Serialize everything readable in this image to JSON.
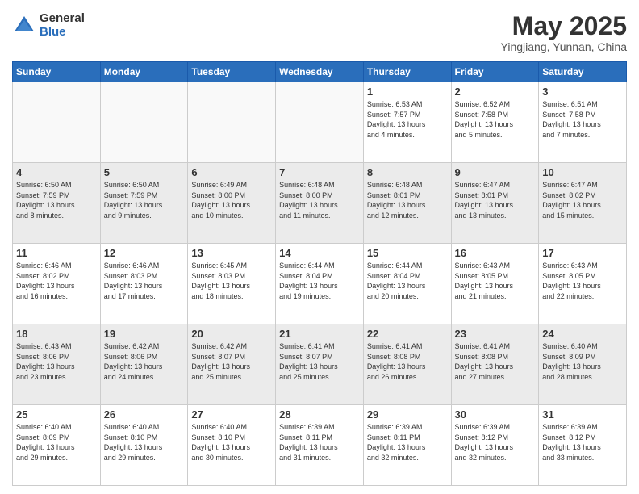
{
  "logo": {
    "general": "General",
    "blue": "Blue"
  },
  "header": {
    "month": "May 2025",
    "location": "Yingjiang, Yunnan, China"
  },
  "weekdays": [
    "Sunday",
    "Monday",
    "Tuesday",
    "Wednesday",
    "Thursday",
    "Friday",
    "Saturday"
  ],
  "weeks": [
    [
      {
        "day": "",
        "info": ""
      },
      {
        "day": "",
        "info": ""
      },
      {
        "day": "",
        "info": ""
      },
      {
        "day": "",
        "info": ""
      },
      {
        "day": "1",
        "info": "Sunrise: 6:53 AM\nSunset: 7:57 PM\nDaylight: 13 hours\nand 4 minutes."
      },
      {
        "day": "2",
        "info": "Sunrise: 6:52 AM\nSunset: 7:58 PM\nDaylight: 13 hours\nand 5 minutes."
      },
      {
        "day": "3",
        "info": "Sunrise: 6:51 AM\nSunset: 7:58 PM\nDaylight: 13 hours\nand 7 minutes."
      }
    ],
    [
      {
        "day": "4",
        "info": "Sunrise: 6:50 AM\nSunset: 7:59 PM\nDaylight: 13 hours\nand 8 minutes."
      },
      {
        "day": "5",
        "info": "Sunrise: 6:50 AM\nSunset: 7:59 PM\nDaylight: 13 hours\nand 9 minutes."
      },
      {
        "day": "6",
        "info": "Sunrise: 6:49 AM\nSunset: 8:00 PM\nDaylight: 13 hours\nand 10 minutes."
      },
      {
        "day": "7",
        "info": "Sunrise: 6:48 AM\nSunset: 8:00 PM\nDaylight: 13 hours\nand 11 minutes."
      },
      {
        "day": "8",
        "info": "Sunrise: 6:48 AM\nSunset: 8:01 PM\nDaylight: 13 hours\nand 12 minutes."
      },
      {
        "day": "9",
        "info": "Sunrise: 6:47 AM\nSunset: 8:01 PM\nDaylight: 13 hours\nand 13 minutes."
      },
      {
        "day": "10",
        "info": "Sunrise: 6:47 AM\nSunset: 8:02 PM\nDaylight: 13 hours\nand 15 minutes."
      }
    ],
    [
      {
        "day": "11",
        "info": "Sunrise: 6:46 AM\nSunset: 8:02 PM\nDaylight: 13 hours\nand 16 minutes."
      },
      {
        "day": "12",
        "info": "Sunrise: 6:46 AM\nSunset: 8:03 PM\nDaylight: 13 hours\nand 17 minutes."
      },
      {
        "day": "13",
        "info": "Sunrise: 6:45 AM\nSunset: 8:03 PM\nDaylight: 13 hours\nand 18 minutes."
      },
      {
        "day": "14",
        "info": "Sunrise: 6:44 AM\nSunset: 8:04 PM\nDaylight: 13 hours\nand 19 minutes."
      },
      {
        "day": "15",
        "info": "Sunrise: 6:44 AM\nSunset: 8:04 PM\nDaylight: 13 hours\nand 20 minutes."
      },
      {
        "day": "16",
        "info": "Sunrise: 6:43 AM\nSunset: 8:05 PM\nDaylight: 13 hours\nand 21 minutes."
      },
      {
        "day": "17",
        "info": "Sunrise: 6:43 AM\nSunset: 8:05 PM\nDaylight: 13 hours\nand 22 minutes."
      }
    ],
    [
      {
        "day": "18",
        "info": "Sunrise: 6:43 AM\nSunset: 8:06 PM\nDaylight: 13 hours\nand 23 minutes."
      },
      {
        "day": "19",
        "info": "Sunrise: 6:42 AM\nSunset: 8:06 PM\nDaylight: 13 hours\nand 24 minutes."
      },
      {
        "day": "20",
        "info": "Sunrise: 6:42 AM\nSunset: 8:07 PM\nDaylight: 13 hours\nand 25 minutes."
      },
      {
        "day": "21",
        "info": "Sunrise: 6:41 AM\nSunset: 8:07 PM\nDaylight: 13 hours\nand 25 minutes."
      },
      {
        "day": "22",
        "info": "Sunrise: 6:41 AM\nSunset: 8:08 PM\nDaylight: 13 hours\nand 26 minutes."
      },
      {
        "day": "23",
        "info": "Sunrise: 6:41 AM\nSunset: 8:08 PM\nDaylight: 13 hours\nand 27 minutes."
      },
      {
        "day": "24",
        "info": "Sunrise: 6:40 AM\nSunset: 8:09 PM\nDaylight: 13 hours\nand 28 minutes."
      }
    ],
    [
      {
        "day": "25",
        "info": "Sunrise: 6:40 AM\nSunset: 8:09 PM\nDaylight: 13 hours\nand 29 minutes."
      },
      {
        "day": "26",
        "info": "Sunrise: 6:40 AM\nSunset: 8:10 PM\nDaylight: 13 hours\nand 29 minutes."
      },
      {
        "day": "27",
        "info": "Sunrise: 6:40 AM\nSunset: 8:10 PM\nDaylight: 13 hours\nand 30 minutes."
      },
      {
        "day": "28",
        "info": "Sunrise: 6:39 AM\nSunset: 8:11 PM\nDaylight: 13 hours\nand 31 minutes."
      },
      {
        "day": "29",
        "info": "Sunrise: 6:39 AM\nSunset: 8:11 PM\nDaylight: 13 hours\nand 32 minutes."
      },
      {
        "day": "30",
        "info": "Sunrise: 6:39 AM\nSunset: 8:12 PM\nDaylight: 13 hours\nand 32 minutes."
      },
      {
        "day": "31",
        "info": "Sunrise: 6:39 AM\nSunset: 8:12 PM\nDaylight: 13 hours\nand 33 minutes."
      }
    ]
  ]
}
